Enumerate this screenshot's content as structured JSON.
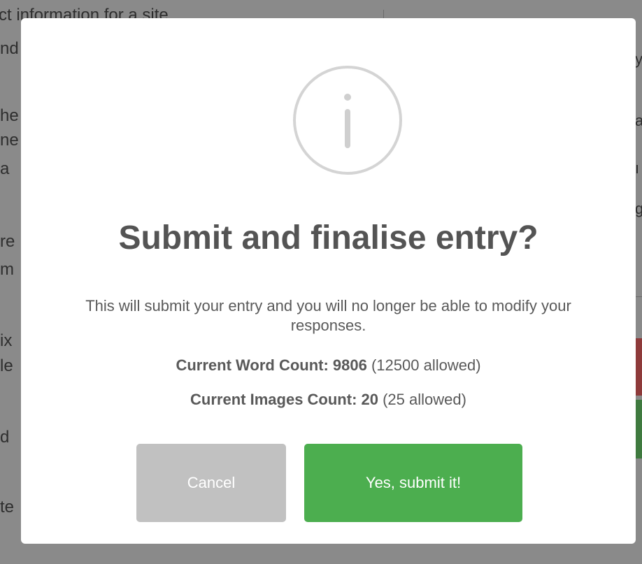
{
  "background": {
    "left_fragments": [
      "ct information for a site",
      "nd",
      "he",
      "ne",
      "a",
      "re",
      "m",
      "ix",
      "le",
      "d",
      "te"
    ],
    "right_fragments": [
      "y",
      "a",
      "ı",
      "g"
    ]
  },
  "dialog": {
    "icon": "info-circle-icon",
    "title": "Submit and finalise entry?",
    "text": "This will submit your entry and you will no longer be able to modify your responses.",
    "word_count_label": "Current Word Count: 9806",
    "word_count_allowed": "(12500 allowed)",
    "images_count_label": "Current Images Count: 20",
    "images_count_allowed": "(25 allowed)",
    "cancel_label": "Cancel",
    "confirm_label": "Yes, submit it!"
  },
  "colors": {
    "confirm": "#4cae4f",
    "cancel": "#c1c1c1",
    "overlay": "#8a8a8a"
  }
}
